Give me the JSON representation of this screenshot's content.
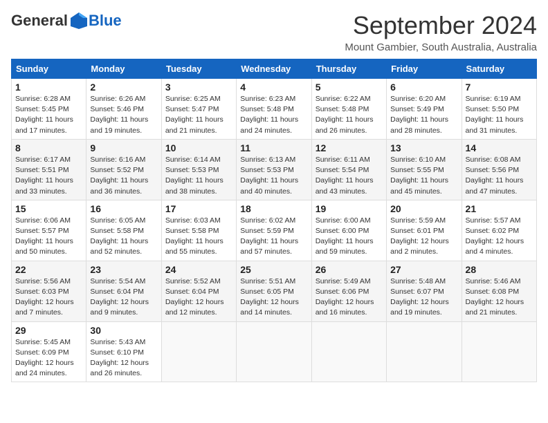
{
  "header": {
    "logo_general": "General",
    "logo_blue": "Blue",
    "month_title": "September 2024",
    "location": "Mount Gambier, South Australia, Australia"
  },
  "weekdays": [
    "Sunday",
    "Monday",
    "Tuesday",
    "Wednesday",
    "Thursday",
    "Friday",
    "Saturday"
  ],
  "weeks": [
    [
      {
        "day": "1",
        "sunrise": "Sunrise: 6:28 AM",
        "sunset": "Sunset: 5:45 PM",
        "daylight": "Daylight: 11 hours and 17 minutes."
      },
      {
        "day": "2",
        "sunrise": "Sunrise: 6:26 AM",
        "sunset": "Sunset: 5:46 PM",
        "daylight": "Daylight: 11 hours and 19 minutes."
      },
      {
        "day": "3",
        "sunrise": "Sunrise: 6:25 AM",
        "sunset": "Sunset: 5:47 PM",
        "daylight": "Daylight: 11 hours and 21 minutes."
      },
      {
        "day": "4",
        "sunrise": "Sunrise: 6:23 AM",
        "sunset": "Sunset: 5:48 PM",
        "daylight": "Daylight: 11 hours and 24 minutes."
      },
      {
        "day": "5",
        "sunrise": "Sunrise: 6:22 AM",
        "sunset": "Sunset: 5:48 PM",
        "daylight": "Daylight: 11 hours and 26 minutes."
      },
      {
        "day": "6",
        "sunrise": "Sunrise: 6:20 AM",
        "sunset": "Sunset: 5:49 PM",
        "daylight": "Daylight: 11 hours and 28 minutes."
      },
      {
        "day": "7",
        "sunrise": "Sunrise: 6:19 AM",
        "sunset": "Sunset: 5:50 PM",
        "daylight": "Daylight: 11 hours and 31 minutes."
      }
    ],
    [
      {
        "day": "8",
        "sunrise": "Sunrise: 6:17 AM",
        "sunset": "Sunset: 5:51 PM",
        "daylight": "Daylight: 11 hours and 33 minutes."
      },
      {
        "day": "9",
        "sunrise": "Sunrise: 6:16 AM",
        "sunset": "Sunset: 5:52 PM",
        "daylight": "Daylight: 11 hours and 36 minutes."
      },
      {
        "day": "10",
        "sunrise": "Sunrise: 6:14 AM",
        "sunset": "Sunset: 5:53 PM",
        "daylight": "Daylight: 11 hours and 38 minutes."
      },
      {
        "day": "11",
        "sunrise": "Sunrise: 6:13 AM",
        "sunset": "Sunset: 5:53 PM",
        "daylight": "Daylight: 11 hours and 40 minutes."
      },
      {
        "day": "12",
        "sunrise": "Sunrise: 6:11 AM",
        "sunset": "Sunset: 5:54 PM",
        "daylight": "Daylight: 11 hours and 43 minutes."
      },
      {
        "day": "13",
        "sunrise": "Sunrise: 6:10 AM",
        "sunset": "Sunset: 5:55 PM",
        "daylight": "Daylight: 11 hours and 45 minutes."
      },
      {
        "day": "14",
        "sunrise": "Sunrise: 6:08 AM",
        "sunset": "Sunset: 5:56 PM",
        "daylight": "Daylight: 11 hours and 47 minutes."
      }
    ],
    [
      {
        "day": "15",
        "sunrise": "Sunrise: 6:06 AM",
        "sunset": "Sunset: 5:57 PM",
        "daylight": "Daylight: 11 hours and 50 minutes."
      },
      {
        "day": "16",
        "sunrise": "Sunrise: 6:05 AM",
        "sunset": "Sunset: 5:58 PM",
        "daylight": "Daylight: 11 hours and 52 minutes."
      },
      {
        "day": "17",
        "sunrise": "Sunrise: 6:03 AM",
        "sunset": "Sunset: 5:58 PM",
        "daylight": "Daylight: 11 hours and 55 minutes."
      },
      {
        "day": "18",
        "sunrise": "Sunrise: 6:02 AM",
        "sunset": "Sunset: 5:59 PM",
        "daylight": "Daylight: 11 hours and 57 minutes."
      },
      {
        "day": "19",
        "sunrise": "Sunrise: 6:00 AM",
        "sunset": "Sunset: 6:00 PM",
        "daylight": "Daylight: 11 hours and 59 minutes."
      },
      {
        "day": "20",
        "sunrise": "Sunrise: 5:59 AM",
        "sunset": "Sunset: 6:01 PM",
        "daylight": "Daylight: 12 hours and 2 minutes."
      },
      {
        "day": "21",
        "sunrise": "Sunrise: 5:57 AM",
        "sunset": "Sunset: 6:02 PM",
        "daylight": "Daylight: 12 hours and 4 minutes."
      }
    ],
    [
      {
        "day": "22",
        "sunrise": "Sunrise: 5:56 AM",
        "sunset": "Sunset: 6:03 PM",
        "daylight": "Daylight: 12 hours and 7 minutes."
      },
      {
        "day": "23",
        "sunrise": "Sunrise: 5:54 AM",
        "sunset": "Sunset: 6:04 PM",
        "daylight": "Daylight: 12 hours and 9 minutes."
      },
      {
        "day": "24",
        "sunrise": "Sunrise: 5:52 AM",
        "sunset": "Sunset: 6:04 PM",
        "daylight": "Daylight: 12 hours and 12 minutes."
      },
      {
        "day": "25",
        "sunrise": "Sunrise: 5:51 AM",
        "sunset": "Sunset: 6:05 PM",
        "daylight": "Daylight: 12 hours and 14 minutes."
      },
      {
        "day": "26",
        "sunrise": "Sunrise: 5:49 AM",
        "sunset": "Sunset: 6:06 PM",
        "daylight": "Daylight: 12 hours and 16 minutes."
      },
      {
        "day": "27",
        "sunrise": "Sunrise: 5:48 AM",
        "sunset": "Sunset: 6:07 PM",
        "daylight": "Daylight: 12 hours and 19 minutes."
      },
      {
        "day": "28",
        "sunrise": "Sunrise: 5:46 AM",
        "sunset": "Sunset: 6:08 PM",
        "daylight": "Daylight: 12 hours and 21 minutes."
      }
    ],
    [
      {
        "day": "29",
        "sunrise": "Sunrise: 5:45 AM",
        "sunset": "Sunset: 6:09 PM",
        "daylight": "Daylight: 12 hours and 24 minutes."
      },
      {
        "day": "30",
        "sunrise": "Sunrise: 5:43 AM",
        "sunset": "Sunset: 6:10 PM",
        "daylight": "Daylight: 12 hours and 26 minutes."
      },
      null,
      null,
      null,
      null,
      null
    ]
  ]
}
